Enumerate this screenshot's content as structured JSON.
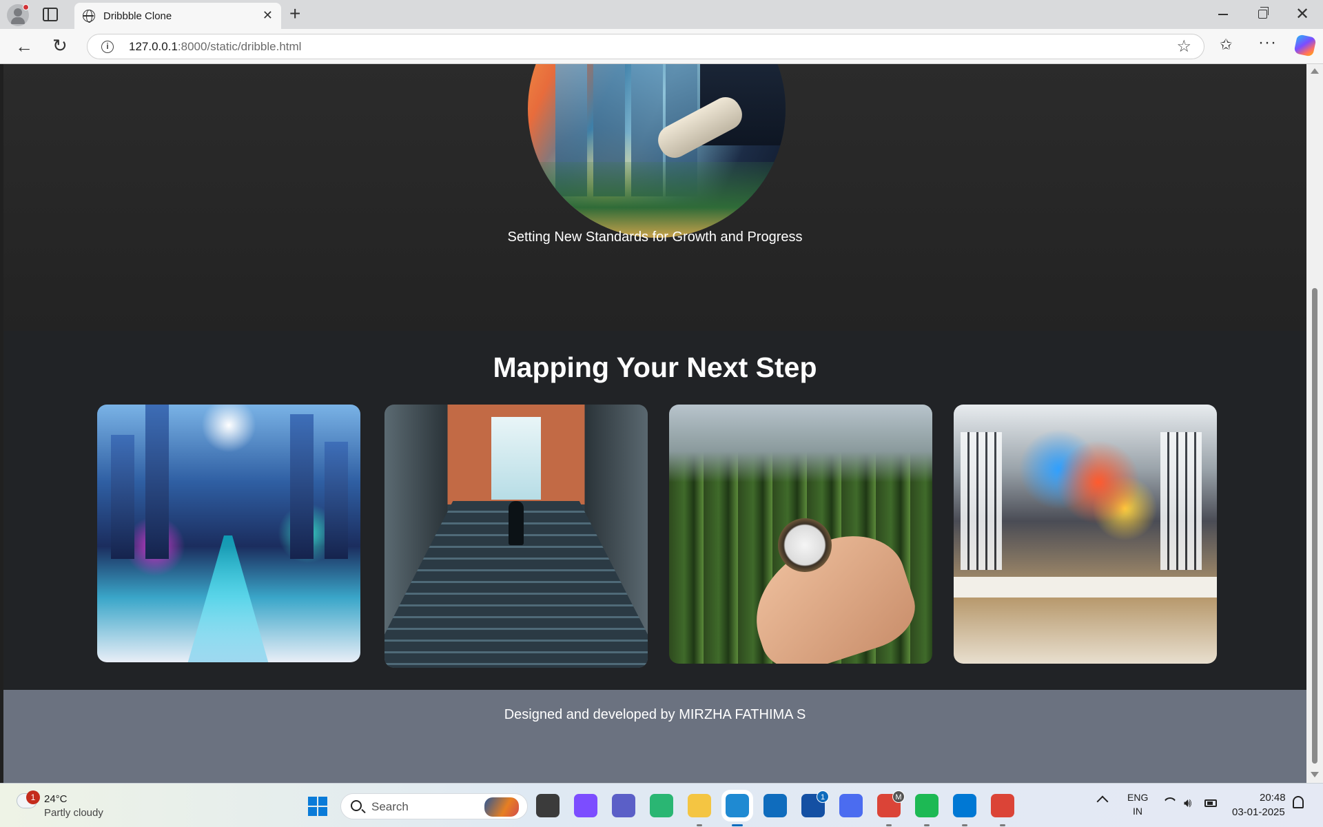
{
  "browser": {
    "tab_title": "Dribbble Clone",
    "url_host": "127.0.0.1",
    "url_rest": ":8000/static/dribble.html"
  },
  "page": {
    "hero_caption": "Setting New Standards for Growth and Progress",
    "section_title": "Mapping Your Next Step",
    "footer_text": "Designed and developed by MIRZHA FATHIMA S",
    "images": [
      {
        "name": "futuristic-city-image"
      },
      {
        "name": "staircase-doorway-image"
      },
      {
        "name": "compass-forest-image"
      },
      {
        "name": "creative-office-image"
      }
    ],
    "colors": {
      "hero_bg": "#2b2b2b",
      "gallery_bg": "#212326",
      "footer_bg": "#6b7280",
      "text": "#ffffff"
    }
  },
  "taskbar": {
    "weather_temp": "24°C",
    "weather_desc": "Partly cloudy",
    "weather_badge": "1",
    "search_label": "Search",
    "lang_primary": "ENG",
    "lang_region": "IN",
    "time": "20:48",
    "date": "03-01-2025",
    "apps": [
      {
        "name": "file-manager-icon",
        "color": "#3b3b3b"
      },
      {
        "name": "copilot-icon",
        "color": "#7c4dff"
      },
      {
        "name": "teams-icon",
        "color": "#5b5fc7"
      },
      {
        "name": "circle-app-icon",
        "color": "#2ab673"
      },
      {
        "name": "file-explorer-icon",
        "color": "#f4c542"
      },
      {
        "name": "edge-icon",
        "color": "#1f8ad2"
      },
      {
        "name": "store-icon",
        "color": "#0f6cbd"
      },
      {
        "name": "l-app-icon",
        "color": "#1450a3"
      },
      {
        "name": "triangle-app-icon",
        "color": "#4b6cf0"
      },
      {
        "name": "chrome-profile-icon",
        "color": "#db4437"
      },
      {
        "name": "spotify-icon",
        "color": "#1db954"
      },
      {
        "name": "vscode-icon",
        "color": "#0078d4"
      },
      {
        "name": "chrome-icon",
        "color": "#db4437"
      }
    ],
    "l_app_badge": "1",
    "chrome_profile_badge": "M"
  }
}
